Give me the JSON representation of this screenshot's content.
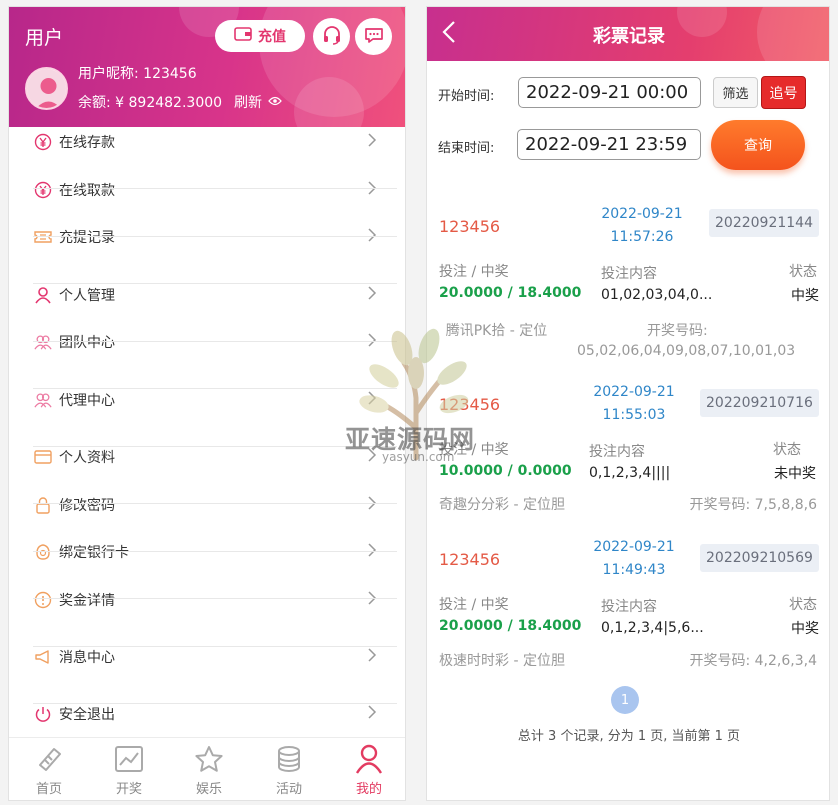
{
  "left": {
    "title": "用户",
    "recharge_label": "充值",
    "nickname": "用户昵称: 123456",
    "balance": "余额: ¥ 892482.3000",
    "refresh": "刷新",
    "menu": [
      {
        "label": "在线存款",
        "icon": "yen-icon"
      },
      {
        "label": "在线取款",
        "icon": "yen-icon"
      },
      {
        "label": "充提记录",
        "icon": "ticket-icon"
      },
      {
        "label": "个人管理",
        "icon": "user-icon"
      },
      {
        "label": "团队中心",
        "icon": "team-icon"
      },
      {
        "label": "代理中心",
        "icon": "team-icon"
      },
      {
        "label": "个人资料",
        "icon": "card-icon"
      },
      {
        "label": "修改密码",
        "icon": "lock-icon"
      },
      {
        "label": "绑定银行卡",
        "icon": "bank-icon"
      },
      {
        "label": "奖金详情",
        "icon": "info-icon"
      },
      {
        "label": "消息中心",
        "icon": "megaphone-icon"
      },
      {
        "label": "安全退出",
        "icon": "power-icon"
      }
    ],
    "tabs": [
      {
        "label": "首页",
        "icon": "ticket-icon"
      },
      {
        "label": "开奖",
        "icon": "chart-icon"
      },
      {
        "label": "娱乐",
        "icon": "star-icon"
      },
      {
        "label": "活动",
        "icon": "coins-icon"
      },
      {
        "label": "我的",
        "icon": "person-icon"
      }
    ]
  },
  "right": {
    "title": "彩票记录",
    "start_label": "开始时间:",
    "start_value": "2022-09-21 00:00",
    "end_label": "结束时间:",
    "end_value": "2022-09-21 23:59",
    "filter_label": "筛选",
    "track_label": "追号",
    "query_label": "查询",
    "records": [
      {
        "user": "123456",
        "date": "2022-09-21",
        "time": "11:57:26",
        "issue": "20220921144",
        "bet_key": "投注 / 中奖",
        "content_key": "投注内容",
        "status_key": "状态",
        "amount": "20.0000 / 18.4000",
        "content": "01,02,03,04,0...",
        "status": "中奖",
        "game": "腾讯PK拾 - 定位",
        "win_key": "开奖号码:",
        "win_numbers": "05,02,06,04,09,08,07,10,01,03"
      },
      {
        "user": "123456",
        "date": "2022-09-21",
        "time": "11:55:03",
        "issue": "202209210716",
        "bet_key": "投注 / 中奖",
        "content_key": "投注内容",
        "status_key": "状态",
        "amount": "10.0000 / 0.0000",
        "content": "0,1,2,3,4||||",
        "status": "未中奖",
        "game": "奇趣分分彩 - 定位胆",
        "win_text": "开奖号码: 7,5,8,8,6"
      },
      {
        "user": "123456",
        "date": "2022-09-21",
        "time": "11:49:43",
        "issue": "202209210569",
        "bet_key": "投注 / 中奖",
        "content_key": "投注内容",
        "status_key": "状态",
        "amount": "20.0000 / 18.4000",
        "content": "0,1,2,3,4|5,6...",
        "status": "中奖",
        "game": "极速时时彩 - 定位胆",
        "win_text": "开奖号码: 4,2,6,3,4"
      }
    ],
    "page_number": "1",
    "summary": "总计 3 个记录, 分为 1 页, 当前第 1 页"
  },
  "watermark": {
    "text": "亚速源码网",
    "sub": "yasyun.com"
  },
  "colors": {
    "header_start": "#b7278a",
    "header_end": "#f0517c",
    "accent": "#e33b61",
    "green": "#1aa04a",
    "blue": "#2f86c8"
  }
}
